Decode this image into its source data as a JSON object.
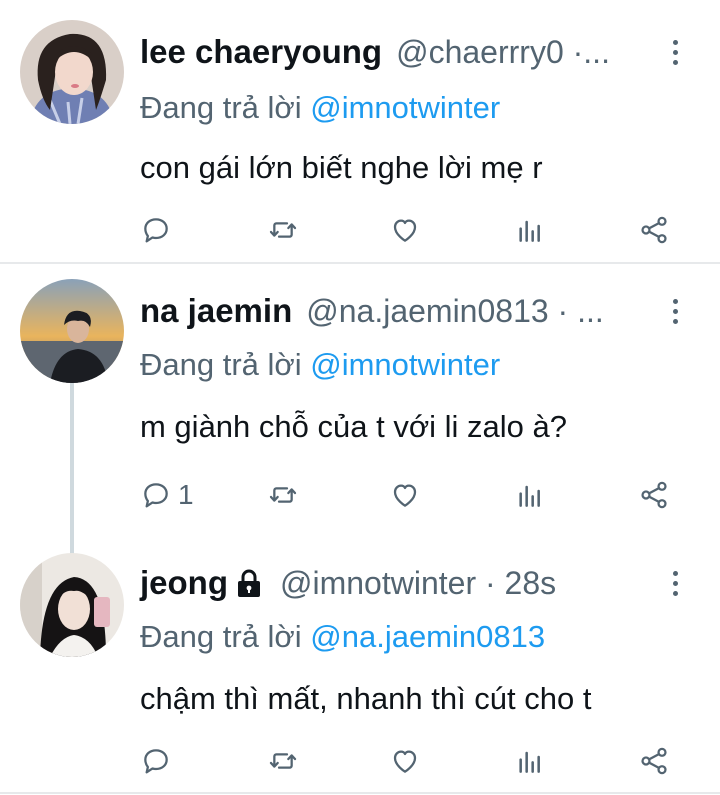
{
  "reply_prefix": "Đang trả lời",
  "tweets": [
    {
      "name": "lee chaeryoung",
      "handle": "@chaerrry0 ·...",
      "replying_to": "@imnotwinter",
      "text": "con gái lớn biết nghe lời mẹ r",
      "reply_count": ""
    },
    {
      "name": "na jaemin",
      "handle": "@na.jaemin0813 · ...",
      "replying_to": "@imnotwinter",
      "text": "m giành chỗ của t với li zalo à?",
      "reply_count": "1"
    },
    {
      "name": "jeong",
      "handle": "@imnotwinter · 28s",
      "replying_to": "@na.jaemin0813",
      "text": "chậm thì mất, nhanh thì cút cho t",
      "reply_count": "",
      "protected": true
    }
  ],
  "icons": [
    "reply-icon",
    "retweet-icon",
    "like-icon",
    "views-icon",
    "share-icon",
    "more-icon",
    "lock-icon"
  ],
  "colors": {
    "link": "#1d9bf0",
    "secondary": "#536471",
    "text": "#0f1419",
    "divider": "#e7e9eb"
  }
}
